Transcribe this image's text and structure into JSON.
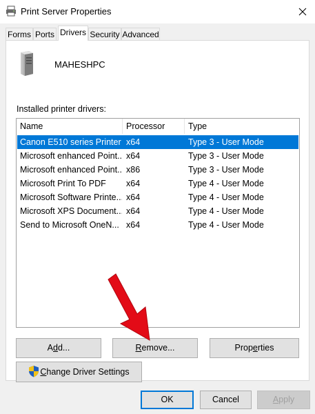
{
  "window": {
    "title": "Print Server Properties",
    "close_icon": "close-icon",
    "app_icon": "printer-icon"
  },
  "tabs": [
    {
      "label": "Forms"
    },
    {
      "label": "Ports"
    },
    {
      "label": "Drivers",
      "selected": true
    },
    {
      "label": "Security"
    },
    {
      "label": "Advanced"
    }
  ],
  "server": {
    "name": "MAHESHPC",
    "icon": "computer-tower-icon"
  },
  "drivers": {
    "label": "Installed printer drivers:",
    "columns": [
      "Name",
      "Processor",
      "Type"
    ],
    "rows": [
      {
        "name": "Canon E510 series Printer",
        "processor": "x64",
        "type": "Type 3 - User Mode",
        "selected": true
      },
      {
        "name": "Microsoft enhanced Point...",
        "processor": "x64",
        "type": "Type 3 - User Mode"
      },
      {
        "name": "Microsoft enhanced Point...",
        "processor": "x86",
        "type": "Type 3 - User Mode"
      },
      {
        "name": "Microsoft Print To PDF",
        "processor": "x64",
        "type": "Type 4 - User Mode"
      },
      {
        "name": "Microsoft Software Printe...",
        "processor": "x64",
        "type": "Type 4 - User Mode"
      },
      {
        "name": "Microsoft XPS Document...",
        "processor": "x64",
        "type": "Type 4 - User Mode"
      },
      {
        "name": "Send to Microsoft OneN...",
        "processor": "x64",
        "type": "Type 4 - User Mode"
      }
    ]
  },
  "buttons": {
    "add": {
      "pre": "A",
      "acc": "d",
      "post": "d..."
    },
    "remove": {
      "pre": "",
      "acc": "R",
      "post": "emove..."
    },
    "properties": {
      "pre": "Prop",
      "acc": "e",
      "post": "rties"
    },
    "change_driver": {
      "pre": "",
      "acc": "C",
      "post": "hange Driver Settings",
      "icon": "uac-shield-icon"
    }
  },
  "footer": {
    "ok": "OK",
    "cancel": "Cancel",
    "apply": {
      "pre": "",
      "acc": "A",
      "post": "pply",
      "disabled": true
    }
  },
  "annotation": {
    "icon": "red-arrow-icon",
    "color": "#e30b17"
  },
  "colors": {
    "selection": "#0078d7",
    "face": "#f0f0f0"
  }
}
